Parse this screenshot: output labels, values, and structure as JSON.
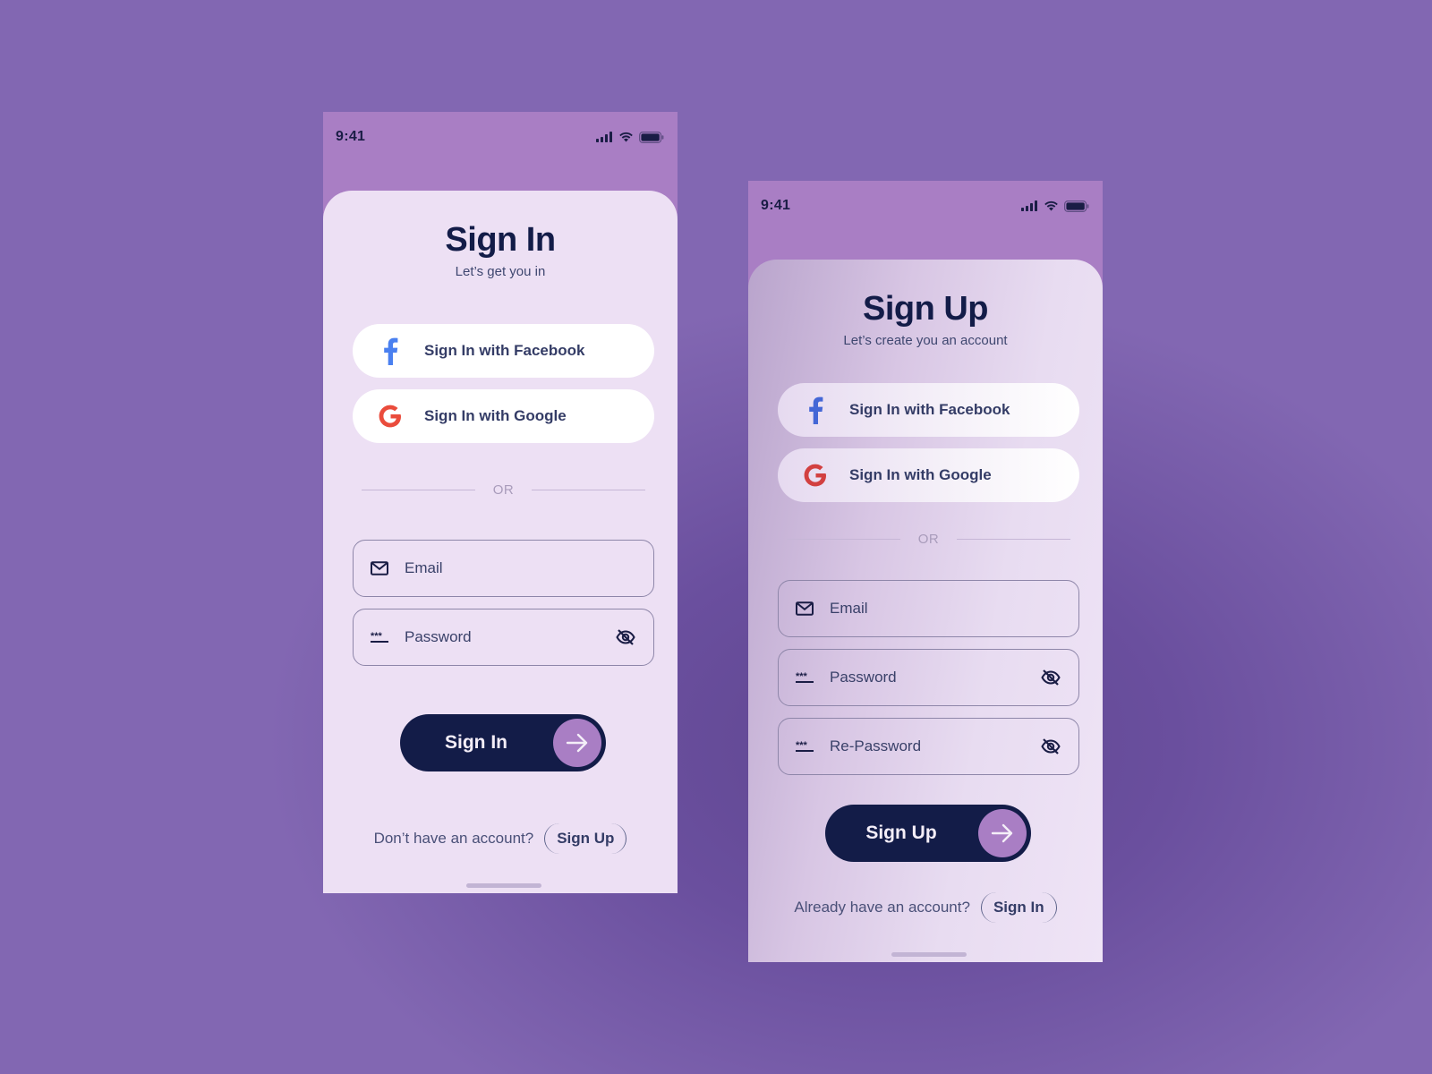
{
  "colors": {
    "background": "#8267b2",
    "phone_header": "#a97ec4",
    "sheet": "#ede0f4",
    "primary": "#131c48",
    "accent": "#a97ec4",
    "facebook": "#4a80f0",
    "google": "#ea4c3c"
  },
  "screens": [
    {
      "status_bar": {
        "time": "9:41",
        "icons": [
          "signal-icon",
          "wifi-icon",
          "battery-icon"
        ]
      },
      "title": "Sign In",
      "subtitle": "Let’s get you in",
      "social_buttons": [
        {
          "icon": "facebook-icon",
          "label": "Sign In with Facebook"
        },
        {
          "icon": "google-icon",
          "label": "Sign In with Google"
        }
      ],
      "divider_label": "OR",
      "fields": [
        {
          "icon": "mail-icon",
          "placeholder": "Email",
          "value": ""
        },
        {
          "icon": "password-icon",
          "placeholder": "Password",
          "value": "",
          "toggle_icon": "eye-off-icon"
        }
      ],
      "primary_button": {
        "label": "Sign In",
        "icon": "arrow-right-icon"
      },
      "footer": {
        "question": "Don’t have an account?",
        "link": "Sign Up"
      }
    },
    {
      "status_bar": {
        "time": "9:41",
        "icons": [
          "signal-icon",
          "wifi-icon",
          "battery-icon"
        ]
      },
      "title": "Sign Up",
      "subtitle": "Let’s create you an account",
      "social_buttons": [
        {
          "icon": "facebook-icon",
          "label": "Sign In with Facebook"
        },
        {
          "icon": "google-icon",
          "label": "Sign In with Google"
        }
      ],
      "divider_label": "OR",
      "fields": [
        {
          "icon": "mail-icon",
          "placeholder": "Email",
          "value": ""
        },
        {
          "icon": "password-icon",
          "placeholder": "Password",
          "value": "",
          "toggle_icon": "eye-off-icon"
        },
        {
          "icon": "password-icon",
          "placeholder": "Re-Password",
          "value": "",
          "toggle_icon": "eye-off-icon"
        }
      ],
      "primary_button": {
        "label": "Sign Up",
        "icon": "arrow-right-icon"
      },
      "footer": {
        "question": "Already have an account?",
        "link": "Sign In"
      }
    }
  ]
}
